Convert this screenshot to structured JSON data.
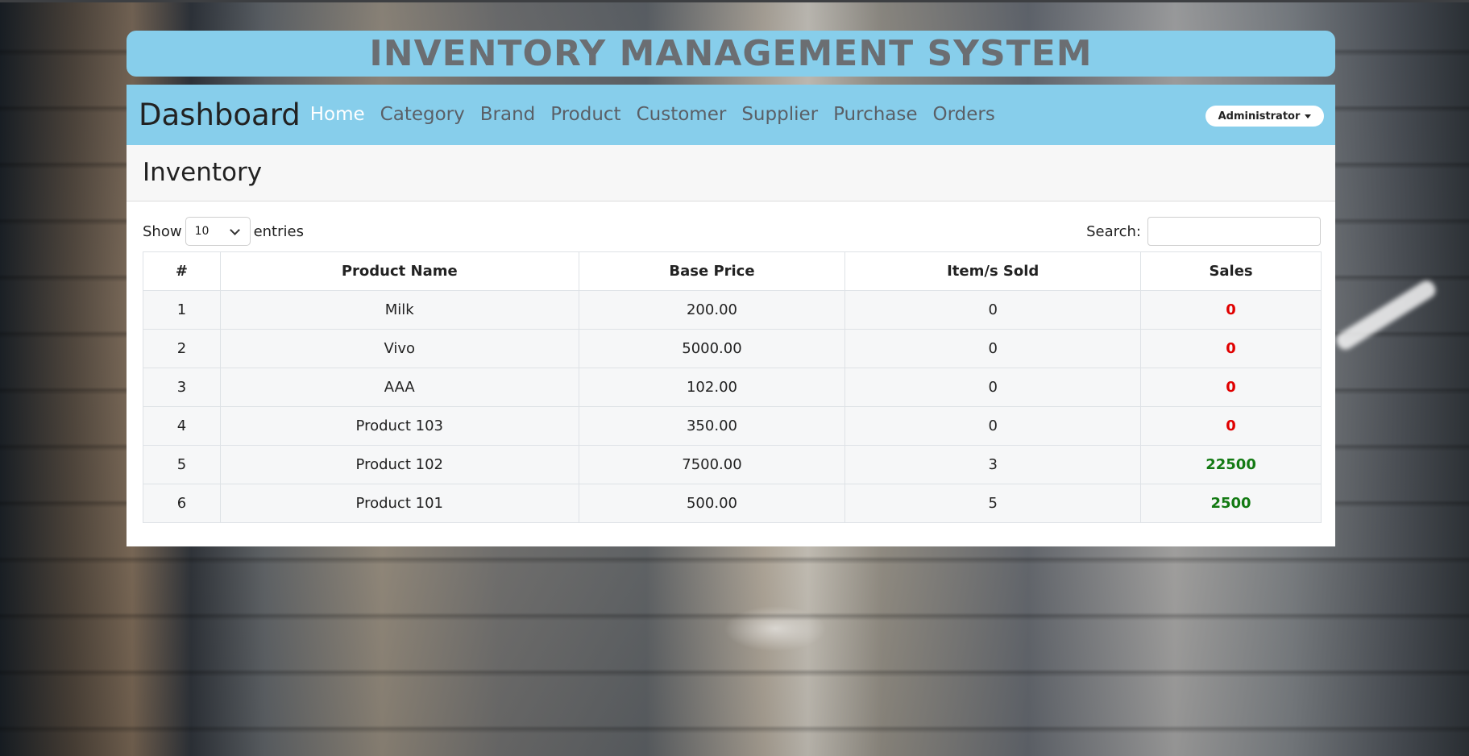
{
  "app_title": "INVENTORY MANAGEMENT SYSTEM",
  "navbar": {
    "brand": "Dashboard",
    "links": [
      "Home",
      "Category",
      "Brand",
      "Product",
      "Customer",
      "Supplier",
      "Purchase",
      "Orders"
    ],
    "active": "Home",
    "user_menu": "Administrator"
  },
  "card": {
    "heading": "Inventory",
    "show_label": "Show",
    "entries_value": "10",
    "entries_label": "entries",
    "search_label": "Search:",
    "search_value": ""
  },
  "table": {
    "columns": [
      "#",
      "Product Name",
      "Base Price",
      "Item/s Sold",
      "Sales"
    ],
    "rows": [
      {
        "num": "1",
        "name": "Milk",
        "price": "200.00",
        "sold": "0",
        "sales": "0",
        "sales_status": "zero"
      },
      {
        "num": "2",
        "name": "Vivo",
        "price": "5000.00",
        "sold": "0",
        "sales": "0",
        "sales_status": "zero"
      },
      {
        "num": "3",
        "name": "AAA",
        "price": "102.00",
        "sold": "0",
        "sales": "0",
        "sales_status": "zero"
      },
      {
        "num": "4",
        "name": "Product 103",
        "price": "350.00",
        "sold": "0",
        "sales": "0",
        "sales_status": "zero"
      },
      {
        "num": "5",
        "name": "Product 102",
        "price": "7500.00",
        "sold": "3",
        "sales": "22500",
        "sales_status": "positive"
      },
      {
        "num": "6",
        "name": "Product 101",
        "price": "500.00",
        "sold": "5",
        "sales": "2500",
        "sales_status": "positive"
      }
    ]
  },
  "colors": {
    "header_bg": "#87ceeb",
    "sales_zero": "#e00000",
    "sales_positive": "#137a13"
  }
}
